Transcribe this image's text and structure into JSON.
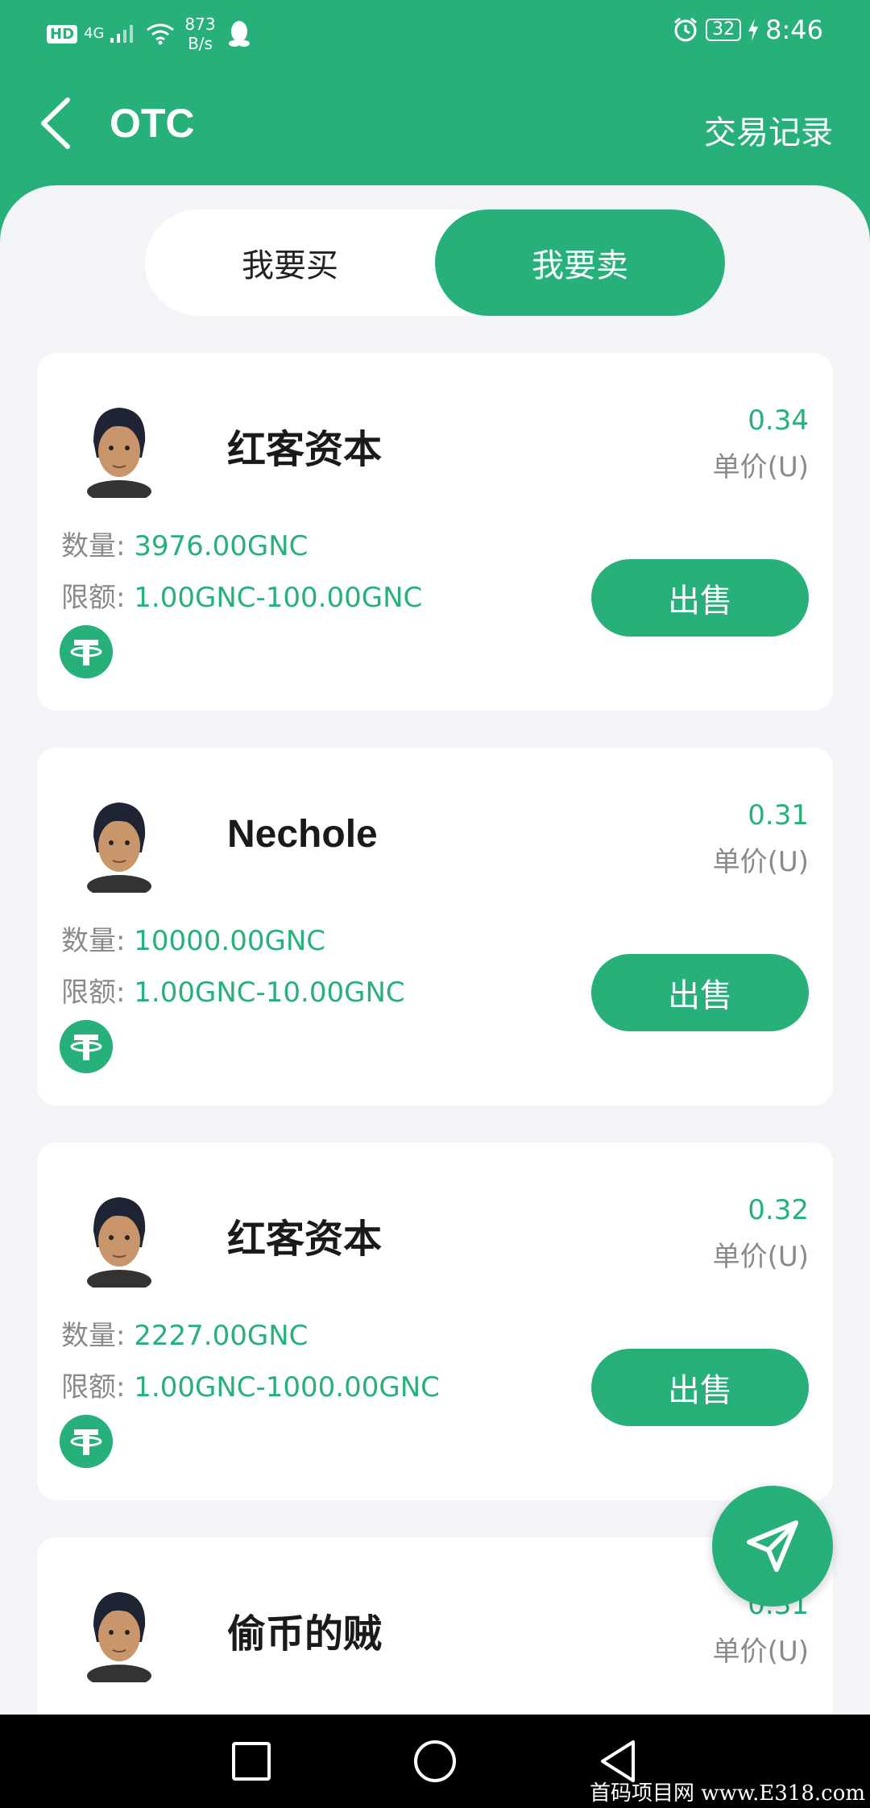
{
  "status_bar": {
    "hd": "HD",
    "network": "4G",
    "speed_value": "873",
    "speed_unit": "B/s",
    "battery": "32",
    "time": "8:46"
  },
  "header": {
    "title": "OTC",
    "records_label": "交易记录"
  },
  "tabs": {
    "buy_label": "我要买",
    "sell_label": "我要卖",
    "active": "sell"
  },
  "labels": {
    "unit_price": "单价(U)",
    "quantity": "数量: ",
    "limit": "限额: ",
    "sell_button": "出售"
  },
  "listings": [
    {
      "name": "红客资本",
      "price": "0.34",
      "quantity": "3976.00GNC",
      "limit": "1.00GNC-100.00GNC"
    },
    {
      "name": "Nechole",
      "price": "0.31",
      "quantity": "10000.00GNC",
      "limit": "1.00GNC-10.00GNC"
    },
    {
      "name": "红客资本",
      "price": "0.32",
      "quantity": "2227.00GNC",
      "limit": "1.00GNC-1000.00GNC"
    },
    {
      "name": "偷币的贼",
      "price": "0.31"
    }
  ],
  "watermark": "首码项目网 www.E318.com",
  "colors": {
    "primary": "#28b07b",
    "background": "#f3f4f7"
  },
  "icons": [
    "back-icon",
    "send-icon",
    "coin-icon",
    "nav-square-icon",
    "nav-circle-icon",
    "nav-back-icon"
  ]
}
